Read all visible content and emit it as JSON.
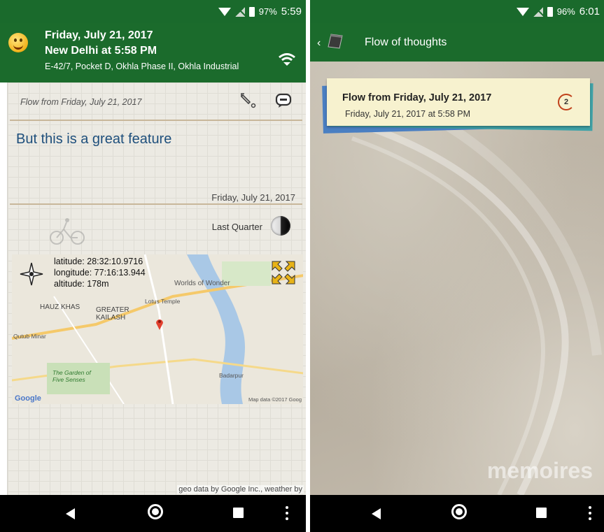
{
  "left_phone": {
    "status": {
      "battery": "97%",
      "time": "5:59"
    },
    "header": {
      "date": "Friday, July 21, 2017",
      "location": "New Delhi at 5:58 PM",
      "address": "E-42/7, Pocket D, Okhla Phase II, Okhla Industrial"
    },
    "note": {
      "flow_label": "Flow from Friday, July 21, 2017",
      "entry_text": "But this is a great feature",
      "entry_date": "Friday, July 21, 2017",
      "moon_phase": "Last Quarter"
    },
    "map": {
      "latitude": "latitude: 28:32:10.9716",
      "longitude": "longitude: 77:16:13.944",
      "altitude": "altitude: 178m",
      "place_labels": [
        "Worlds of Wonder",
        "Lotus Temple",
        "HAUZ KHAS",
        "GREATER KAILASH",
        "Qutub Minar",
        "The Garden of Five Senses",
        "Badarpur",
        "Map data ©2017 Goog"
      ],
      "google": "Google"
    },
    "footer": "geo data by Google Inc., weather by"
  },
  "right_phone": {
    "status": {
      "battery": "96%",
      "time": "6:01"
    },
    "title": "Flow of thoughts",
    "card": {
      "title": "Flow from Friday, July 21, 2017",
      "subtitle": "Friday, July 21, 2017 at 5:58 PM",
      "count": "2"
    },
    "watermark": "memoires"
  },
  "colors": {
    "app_green": "#1b6b2c",
    "entry_blue": "#1e4f7c",
    "note_bg": "#eceae3",
    "card_yellow": "#f7f2cf"
  },
  "icons": [
    "wifi-icon",
    "signal-icon",
    "battery-icon",
    "smiley-icon",
    "wifi-toggle-icon",
    "pencil-icon",
    "comment-icon",
    "moon-icon",
    "cyclist-icon",
    "compass-icon",
    "expand-icon",
    "map-pin-icon",
    "back-icon",
    "home-icon",
    "recents-icon",
    "overflow-menu-icon",
    "book-icon"
  ]
}
